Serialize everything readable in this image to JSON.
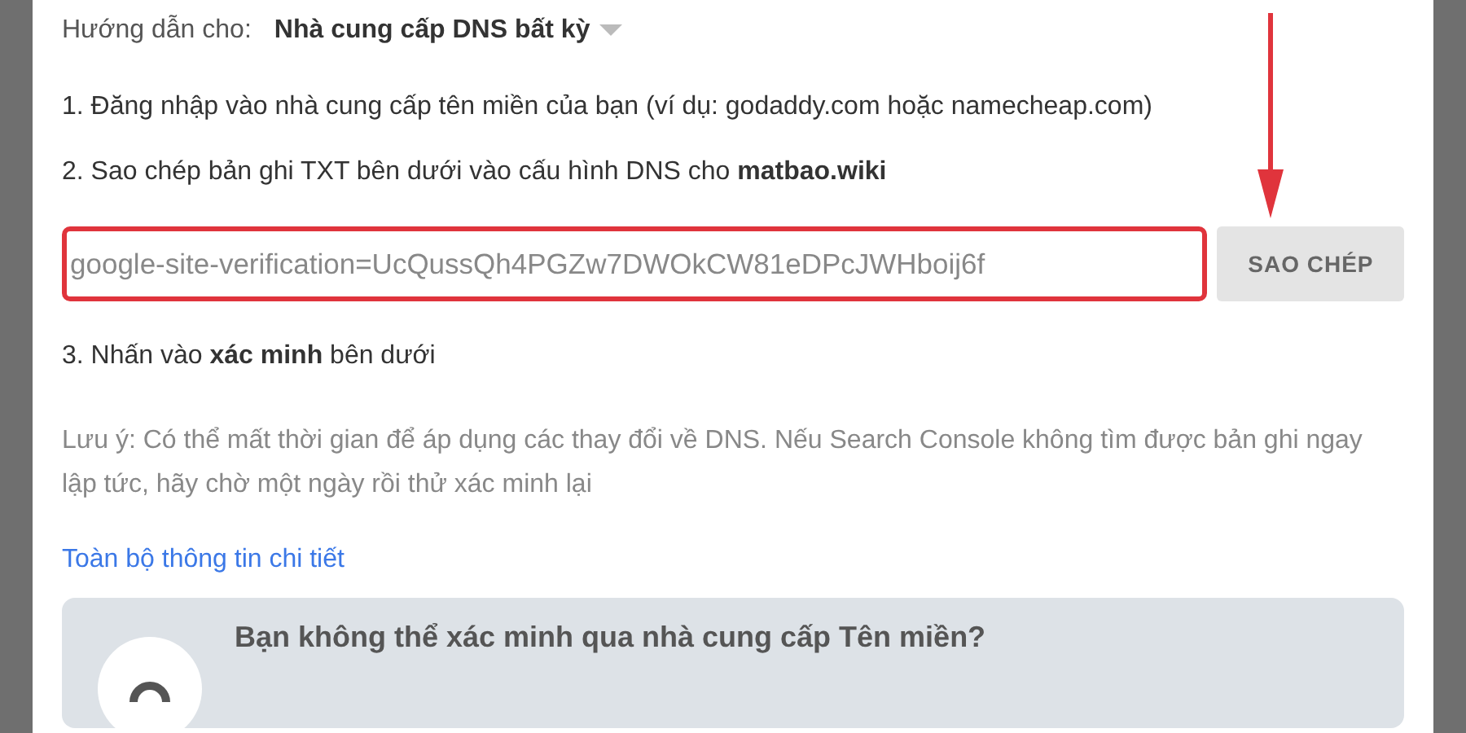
{
  "instructions_for": {
    "label": "Hướng dẫn cho:",
    "value": "Nhà cung cấp DNS bất kỳ"
  },
  "step_1": "1. Đăng nhập vào nhà cung cấp tên miền của bạn (ví dụ: godaddy.com hoặc namecheap.com)",
  "step_2": "2. Sao chép bản ghi TXT bên dưới vào cấu hình DNS cho **matbao.wiki**",
  "txt_record": {
    "value": "google-site-verification=UcQussQh4PGZw7DWOkCW81eDPcJWHboij6f",
    "highlighted": true
  },
  "copy_button": "SAO CHÉP",
  "annotation_arrow": true,
  "step_3": "3. Nhấn vào **xác minh** bên dưới",
  "note": "Lưu ý: Có thể mất thời gian để áp dụng các thay đổi về DNS. Nếu Search Console không tìm được bản ghi ngay lập tức, hãy chờ một ngày rồi thử xác minh lại",
  "details_link": "Toàn bộ thông tin chi tiết",
  "alt_card": {
    "title": "Bạn không thể xác minh qua nhà cung cấp Tên miền?"
  }
}
